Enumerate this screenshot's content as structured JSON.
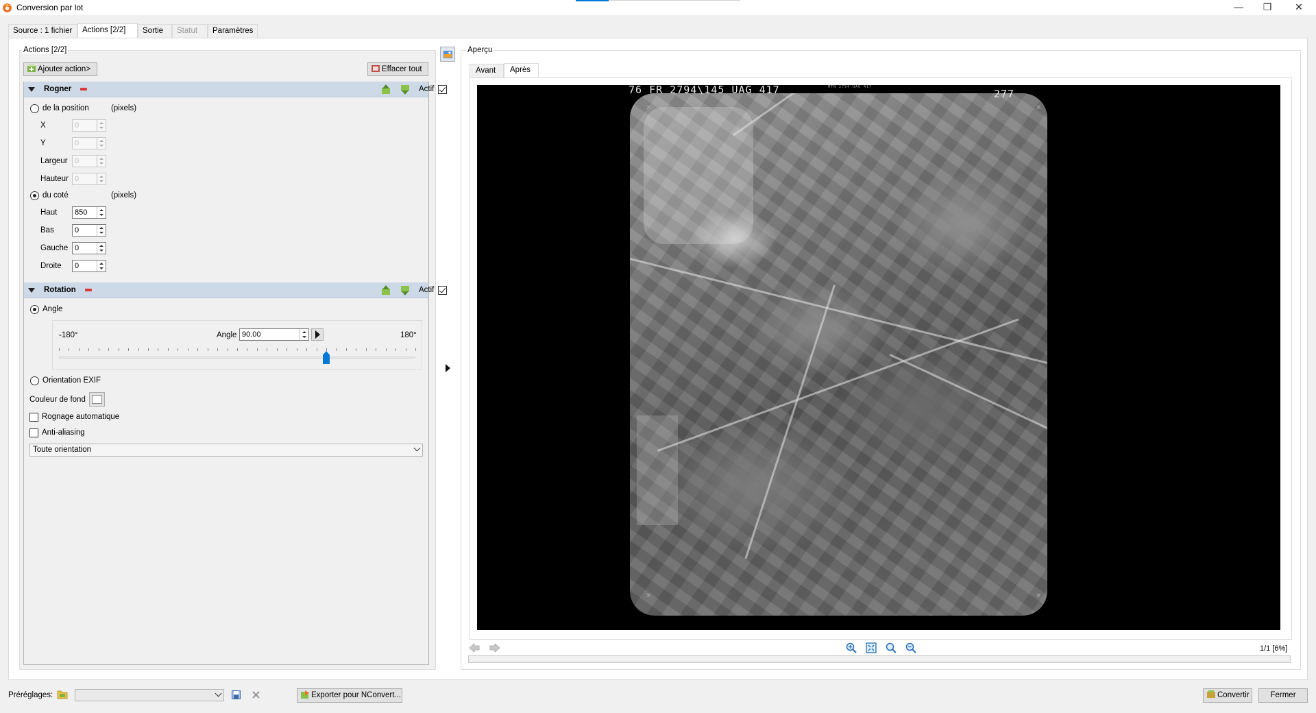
{
  "window": {
    "title": "Conversion par lot",
    "controls": [
      "—",
      "❐",
      "✕"
    ]
  },
  "tabs": [
    {
      "label": "Source : 1 fichier"
    },
    {
      "label": "Actions [2/2]"
    },
    {
      "label": "Sortie"
    },
    {
      "label": "Statut"
    },
    {
      "label": "Paramètres"
    }
  ],
  "actions": {
    "group_label": "Actions [2/2]",
    "add_button": "Ajouter action>",
    "clear_button": "Effacer tout",
    "rogner": {
      "title": "Rogner",
      "actif_label": "Actif",
      "actif": true,
      "from_position_label": "de la position",
      "pixels_label": "(pixels)",
      "position_fields": [
        {
          "label": "X",
          "value": "0"
        },
        {
          "label": "Y",
          "value": "0"
        },
        {
          "label": "Largeur",
          "value": "0"
        },
        {
          "label": "Hauteur",
          "value": "0"
        }
      ],
      "from_side_label": "du coté",
      "side_fields": [
        {
          "label": "Haut",
          "value": "850"
        },
        {
          "label": "Bas",
          "value": "0"
        },
        {
          "label": "Gauche",
          "value": "0"
        },
        {
          "label": "Droite",
          "value": "0"
        }
      ]
    },
    "rotation": {
      "title": "Rotation",
      "actif_label": "Actif",
      "actif": true,
      "angle_radio": "Angle",
      "min_label": "-180°",
      "max_label": "180°",
      "angle_label": "Angle",
      "angle_value": "90.00",
      "angle_fraction": 0.75,
      "exif_label": "Orientation EXIF",
      "bg_color_label": "Couleur de fond",
      "auto_crop_label": "Rognage automatique",
      "antialias_label": "Anti-aliasing",
      "orientation_select": "Toute orientation"
    }
  },
  "preview": {
    "label": "Aperçu",
    "tabs": [
      "Avant",
      "Après"
    ],
    "film_left": "76 FR 2794\\145 UAG 417",
    "film_small": "MTN 2794 UAG 417",
    "film_right": "277",
    "page_info": "1/1 [6%]"
  },
  "footer": {
    "presets_label": "Préréglages:",
    "preset_value": "",
    "export_button": "Exporter pour NConvert...",
    "convert_button": "Convertir",
    "close_button": "Fermer"
  },
  "colors": {
    "accent": "#0078d7",
    "section_header": "#cdd9e6"
  },
  "icons": [
    "app-logo-icon",
    "folder-icon",
    "save-icon",
    "delete-icon",
    "move-up-icon",
    "move-down-icon",
    "zoom-in-icon",
    "fit-icon",
    "zoom-icon",
    "zoom-out-icon",
    "prev-arrow-icon",
    "next-arrow-icon",
    "convert-icon",
    "export-icon",
    "add-action-icon",
    "clear-icon",
    "preview-toggle-icon"
  ]
}
